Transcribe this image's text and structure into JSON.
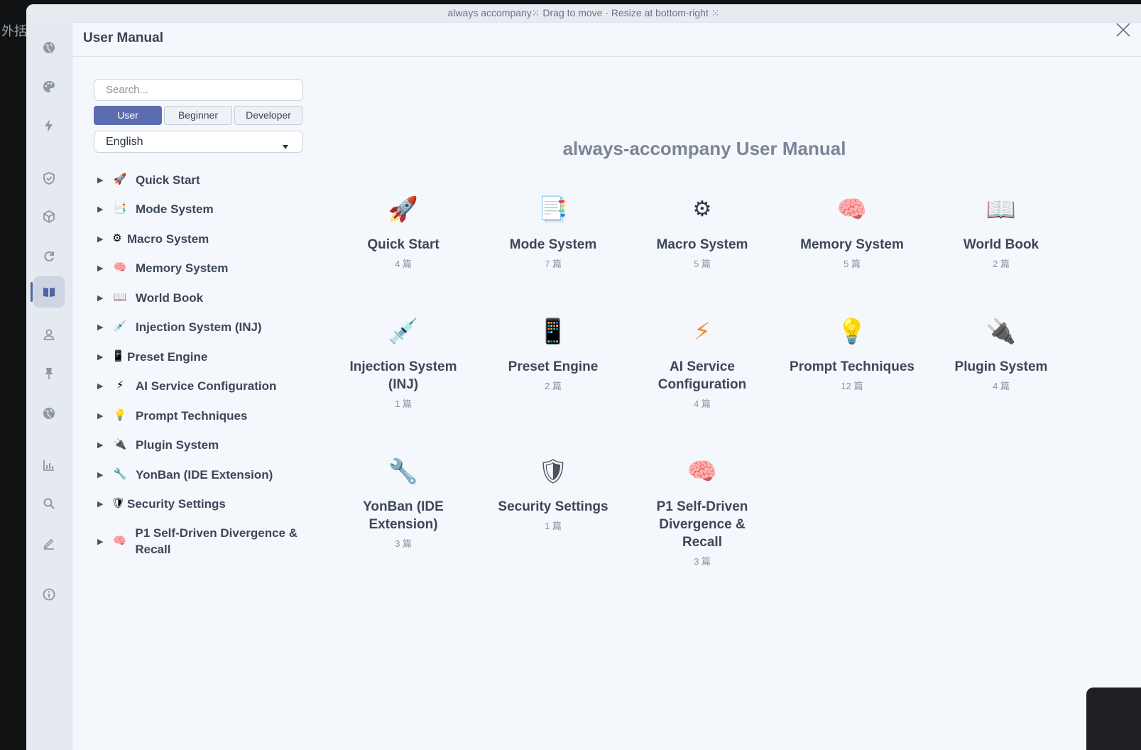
{
  "background_text": "外括",
  "window": {
    "titlebar": "always accompany⁙ Drag to move · Resize at bottom-right ⁙"
  },
  "panel": {
    "title": "User Manual"
  },
  "rail_icons": [
    "globe-icon",
    "palette-icon",
    "lightning-icon",
    "shield-check-icon",
    "cube-icon",
    "refresh-icon",
    "book-icon",
    "user-icon",
    "pin-icon",
    "globe-icon",
    "chart-icon",
    "search-icon",
    "edit-icon",
    "info-icon"
  ],
  "sidebar": {
    "search_placeholder": "Search...",
    "audience": {
      "user": "User",
      "beginner": "Beginner",
      "developer": "Developer",
      "active": "User"
    },
    "language": "English"
  },
  "tree": [
    {
      "icon": "🚀",
      "label": "Quick Start"
    },
    {
      "icon": "📑",
      "label": "Mode System"
    },
    {
      "icon": "⚙",
      "label": "Macro System"
    },
    {
      "icon": "🧠",
      "label": "Memory System"
    },
    {
      "icon": "📖",
      "label": "World Book"
    },
    {
      "icon": "💉",
      "label": "Injection System (INJ)"
    },
    {
      "icon": "📱",
      "label": "Preset Engine"
    },
    {
      "icon": "⚡",
      "label": "AI Service Configuration"
    },
    {
      "icon": "💡",
      "label": "Prompt Techniques"
    },
    {
      "icon": "🔌",
      "label": "Plugin System"
    },
    {
      "icon": "🔧",
      "label": "YonBan (IDE Extension)"
    },
    {
      "icon": "🛡",
      "label": "Security Settings"
    },
    {
      "icon": "🧠",
      "label": "P1 Self-Driven Divergence & Recall"
    }
  ],
  "main": {
    "title": "always-accompany User Manual",
    "cards": [
      {
        "icon": "🚀",
        "title": "Quick Start",
        "count": "4 篇"
      },
      {
        "icon": "📑",
        "title": "Mode System",
        "count": "7 篇"
      },
      {
        "icon": "⚙",
        "title": "Macro System",
        "count": "5 篇"
      },
      {
        "icon": "🧠",
        "title": "Memory System",
        "count": "5 篇"
      },
      {
        "icon": "📖",
        "title": "World Book",
        "count": "2 篇"
      },
      {
        "icon": "💉",
        "title": "Injection System (INJ)",
        "count": "1 篇"
      },
      {
        "icon": "📱",
        "title": "Preset Engine",
        "count": "2 篇"
      },
      {
        "icon": "⚡",
        "title": "AI Service Configuration",
        "count": "4 篇"
      },
      {
        "icon": "💡",
        "title": "Prompt Techniques",
        "count": "12 篇"
      },
      {
        "icon": "🔌",
        "title": "Plugin System",
        "count": "4 篇"
      },
      {
        "icon": "🔧",
        "title": "YonBan (IDE Extension)",
        "count": "3 篇"
      },
      {
        "icon": "🛡",
        "title": "Security Settings",
        "count": "1 篇"
      },
      {
        "icon": "🧠",
        "title": "P1 Self-Driven Divergence & Recall",
        "count": "3 篇"
      }
    ]
  }
}
